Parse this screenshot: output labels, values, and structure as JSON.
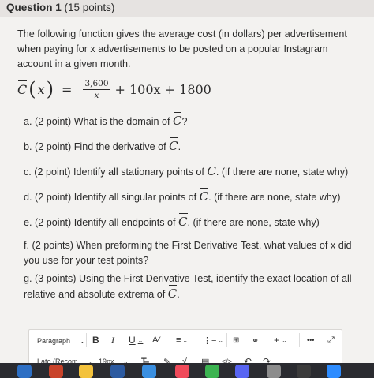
{
  "header": {
    "question_number": "Question 1",
    "points": "(15 points)"
  },
  "intro": "The following function gives the average cost (in dollars) per advertisement when paying for x advertisements to be posted on a popular Instagram account in a given month.",
  "formula": {
    "lhs_symbol": "C",
    "variable": "x",
    "numerator": "3,600",
    "denominator": "x",
    "rest": "+ 100x + 1800"
  },
  "questions": {
    "a": "a. (2 point) What is the domain of",
    "a_end": "?",
    "b": "b. (2 point) Find the derivative of",
    "b_end": ".",
    "c": "c. (2 point) Identify all stationary points of",
    "c_end": ". (if there are none, state why)",
    "d": "d. (2 point) Identify all singular points of",
    "d_end": ". (if there are none, state why)",
    "e": "e. (2 point) Identify all endpoints of",
    "e_end": ". (if there are none, state why)",
    "f": "f. (2 points) When preforming the First Derivative Test, what values of x did you use for your test points?",
    "g": "g. (3 points) Using the First Derivative Test, identify the exact location of all relative and absolute extrema of",
    "g_end": "."
  },
  "toolbar": {
    "paragraph_label": "Paragraph",
    "bold_label": "B",
    "italic_label": "I",
    "underline_label": "U",
    "font_label": "Lato (Recom...",
    "size_label": "19px...",
    "more_label": "•••"
  },
  "colors": {
    "background": "#f3f2f0",
    "header": "#e6e3e1",
    "dock": "#2a2b30"
  },
  "icons": [
    "chevron-down-icon",
    "text-color-icon",
    "align-icon",
    "list-icon",
    "table-icon",
    "link-icon",
    "plus-icon",
    "more-icon",
    "expand-icon",
    "clear-format-icon",
    "highlight-icon",
    "math-icon",
    "document-icon",
    "code-icon",
    "undo-icon",
    "redo-icon"
  ]
}
